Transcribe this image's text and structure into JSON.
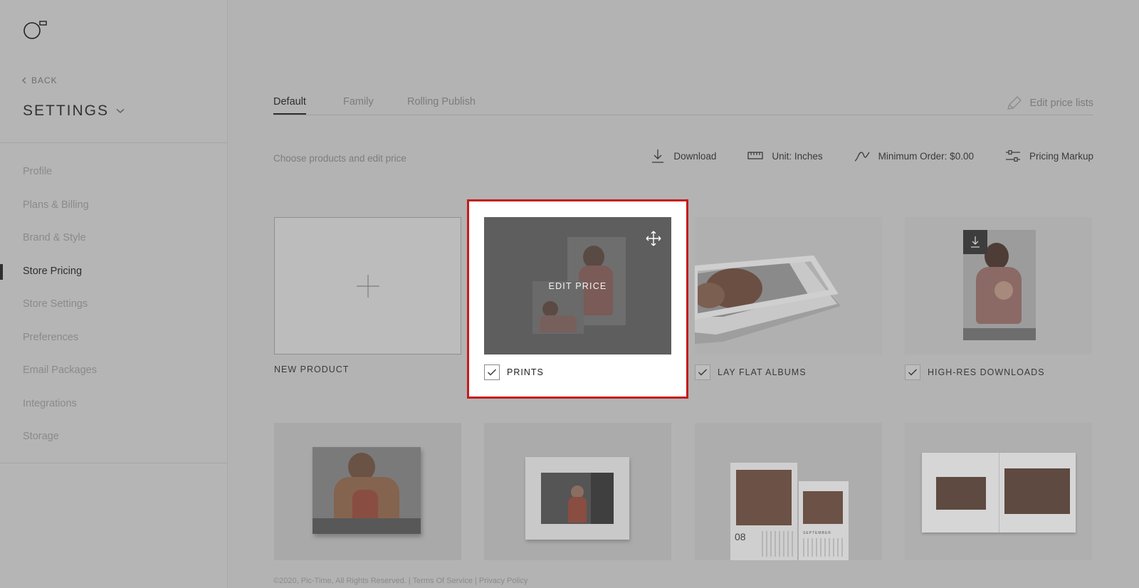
{
  "sidebar": {
    "back_label": "BACK",
    "title": "SETTINGS",
    "items": [
      {
        "label": "Profile",
        "active": false
      },
      {
        "label": "Plans & Billing",
        "active": false
      },
      {
        "label": "Brand & Style",
        "active": false
      },
      {
        "label": "Store Pricing",
        "active": true
      },
      {
        "label": "Store Settings",
        "active": false
      },
      {
        "label": "Preferences",
        "active": false
      },
      {
        "label": "Email Packages",
        "active": false
      },
      {
        "label": "Integrations",
        "active": false
      },
      {
        "label": "Storage",
        "active": false
      }
    ]
  },
  "tabs": [
    {
      "label": "Default",
      "active": true
    },
    {
      "label": "Family",
      "active": false
    },
    {
      "label": "Rolling Publish",
      "active": false
    }
  ],
  "edit_price_lists": "Edit price lists",
  "subtitle": "Choose products and edit price",
  "toolbar": {
    "download": "Download",
    "unit": "Unit: Inches",
    "minimum_order": "Minimum Order: $0.00",
    "pricing_markup": "Pricing Markup"
  },
  "products": {
    "new_product": "NEW PRODUCT",
    "prints": "PRINTS",
    "prints_overlay": "EDIT PRICE",
    "lay_flat_albums": "LAY FLAT ALBUMS",
    "high_res_downloads": "HIGH-RES DOWNLOADS"
  },
  "calendar_number": "08",
  "calendar_month": "SEPTEMBER",
  "footer": "©2020, Pic-Time, All Rights Reserved. | Terms Of Service | Privacy Policy"
}
